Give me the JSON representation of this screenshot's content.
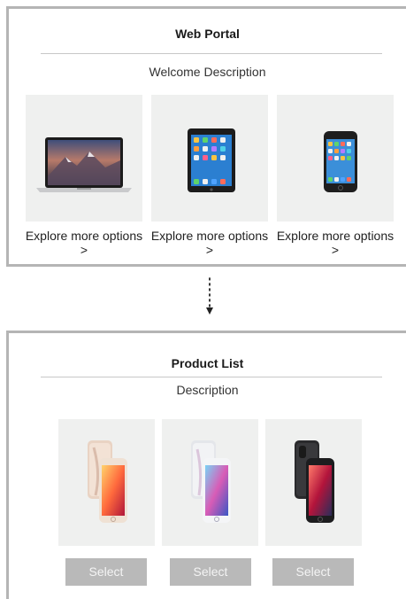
{
  "portal": {
    "title": "Web Portal",
    "description": "Welcome Description",
    "cards": [
      {
        "icon": "laptop-icon",
        "label": "Explore more options >"
      },
      {
        "icon": "tablet-icon",
        "label": "Explore more options >"
      },
      {
        "icon": "phone-icon",
        "label": "Explore more options >"
      }
    ]
  },
  "product_list": {
    "title": "Product List",
    "description": "Description",
    "products": [
      {
        "icon": "phone-gold-icon",
        "button": "Select"
      },
      {
        "icon": "phone-silver-icon",
        "button": "Select"
      },
      {
        "icon": "phone-black-icon",
        "button": "Select"
      }
    ]
  },
  "colors": {
    "frame_border": "#b5b5b5",
    "card_background": "#eff0ef",
    "button_background": "#b9b9b9",
    "button_text": "#f4f4f4"
  }
}
